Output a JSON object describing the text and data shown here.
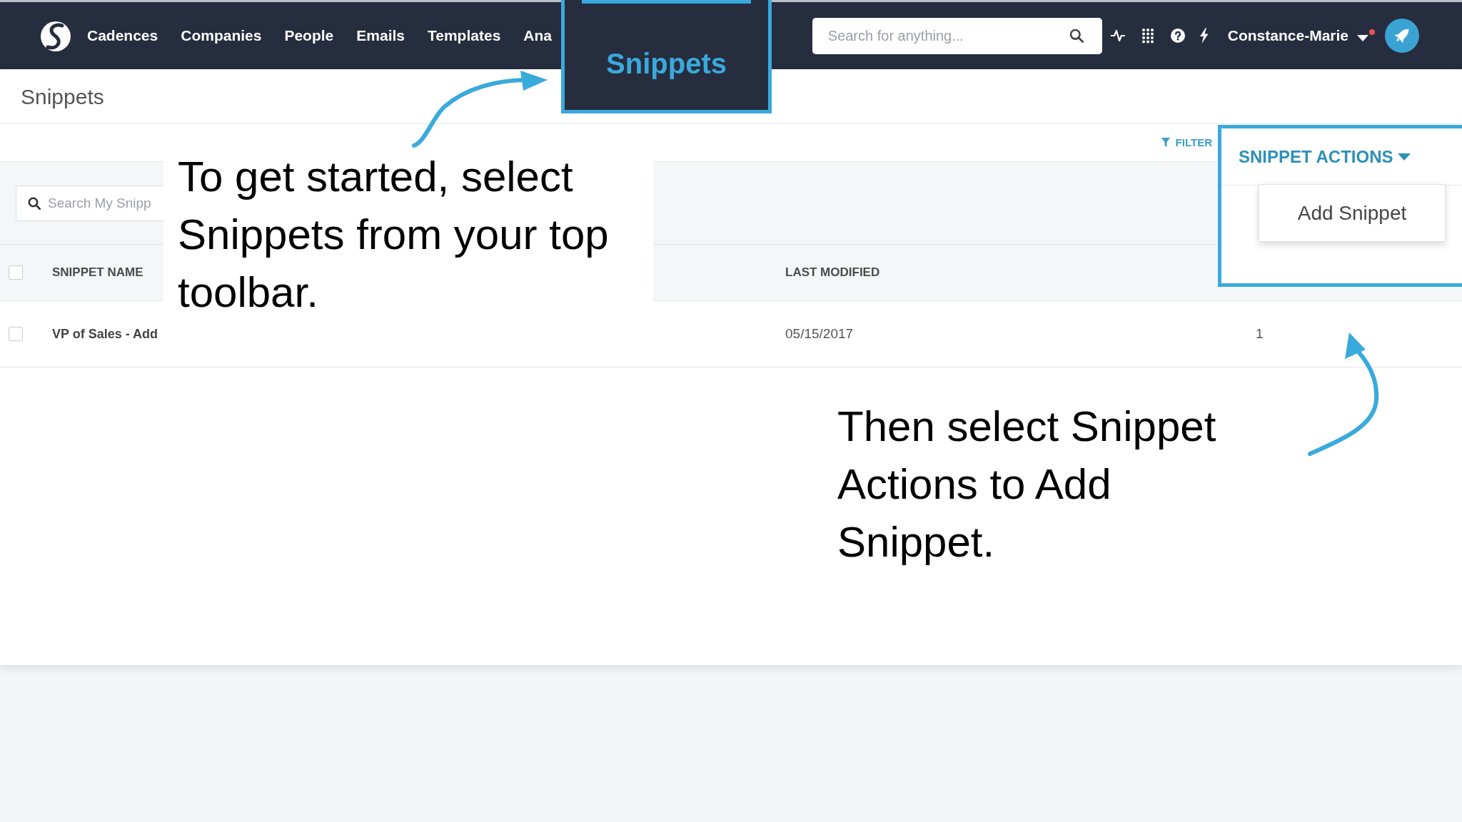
{
  "navbar": {
    "items": [
      {
        "label": "Cadences"
      },
      {
        "label": "Companies"
      },
      {
        "label": "People"
      },
      {
        "label": "Emails"
      },
      {
        "label": "Templates"
      },
      {
        "label": "Ana"
      }
    ],
    "search": {
      "placeholder": "Search for anything..."
    },
    "user": {
      "name": "Constance-Marie",
      "unread": true
    }
  },
  "zoom_callout": {
    "label": "Snippets",
    "selected": true
  },
  "page": {
    "title": "Snippets"
  },
  "toolbar": {
    "filter": "FILTER",
    "actions": {
      "label": "SNIPPET ACTIONS",
      "expanded": true,
      "menu": [
        {
          "label": "Add Snippet"
        }
      ]
    }
  },
  "search": {
    "placeholder": "Search My Snipp"
  },
  "table": {
    "select_all_checked": false,
    "columns": [
      {
        "label": "SNIPPET NAME"
      },
      {
        "label": "LAST MODIFIED"
      }
    ],
    "rows": [
      {
        "checked": false,
        "name": "VP of Sales - Add",
        "last_modified": "05/15/2017",
        "column_3": "1"
      }
    ]
  },
  "annotations": [
    {
      "text": "To get started, select Snippets from your top toolbar."
    },
    {
      "text": "Then select Snippet Actions to Add Snippet."
    }
  ]
}
